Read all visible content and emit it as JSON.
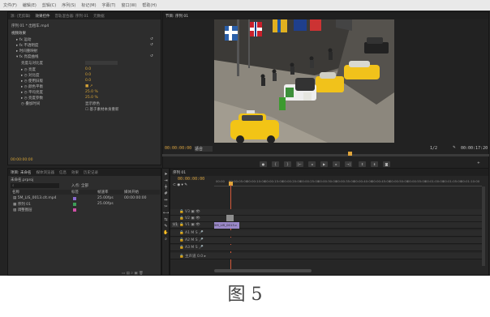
{
  "menu": [
    "文件(F)",
    "编辑(E)",
    "剪辑(C)",
    "序列(S)",
    "标记(M)",
    "字幕(T)",
    "窗口(W)",
    "帮助(H)"
  ],
  "top_left_panel": {
    "tabs": [
      "源: (无剪辑)",
      "效果控件",
      "音轨混合器: 序列 01",
      "元数据"
    ],
    "header": "序列 01 * 出租车.mp4",
    "section": "视频效果",
    "effects": [
      {
        "label": "运动",
        "value": ""
      },
      {
        "label": "不透明度",
        "value": ""
      },
      {
        "label": "时间重映射",
        "value": ""
      },
      {
        "label": "亮度曲线",
        "value": ""
      }
    ],
    "sub_label": "亮度与对比度",
    "params": [
      {
        "label": "亮度",
        "value": "0.0"
      },
      {
        "label": "对比度",
        "value": "0.0"
      },
      {
        "label": "使用旧版",
        "value": "0.0"
      },
      {
        "label": "颜色平衡",
        "value": "0.0"
      },
      {
        "label": "平均亮度",
        "value": "25.0 %"
      },
      {
        "label": "亮度参数",
        "value": "25.0 %"
      }
    ],
    "extra_label": "叠加时间",
    "extra_value": "显示原色",
    "extra_value2": "基于素材本身重新"
  },
  "program": {
    "title": "节目: 序列 01",
    "timecode_left": "00:00:00:00",
    "fit": "适合",
    "zoom": "1/2",
    "timecode_right": "00:00:17:20"
  },
  "project": {
    "tabs": [
      "项目: 未命名",
      "媒体浏览器",
      "信息",
      "效果",
      "历史记录"
    ],
    "name": "未命名.prproj",
    "search_hint": "入点: 全部",
    "columns": [
      "名称",
      "标签",
      "帧速率",
      "媒体开始"
    ],
    "items": [
      {
        "name": "5M_LIS_0013.clt.mp4",
        "rate": "25.00fps",
        "start": "00:00:00:00",
        "color": "#8a6ad0"
      },
      {
        "name": "序列 01",
        "rate": "25.00fps",
        "start": "",
        "color": "#3d9e57"
      },
      {
        "name": "调整图层",
        "rate": "",
        "start": "",
        "color": "#cf4fa6"
      }
    ]
  },
  "timeline": {
    "title": "序列 01",
    "timecode": "00:00:00:00",
    "ruler": [
      "00:00",
      "00:00:05:00",
      "00:00:10:00",
      "00:00:15:00",
      "00:00:20:00",
      "00:00:25:00",
      "00:00:30:00",
      "00:00:35:00",
      "00:00:40:00",
      "00:00:45:00",
      "00:00:50:00",
      "00:00:55:00",
      "00:01:00:00",
      "00:01:05:00",
      "00:01:10:00",
      "00:01:15:00"
    ],
    "video_tracks": [
      "V3",
      "V2",
      "V1"
    ],
    "audio_tracks": [
      "A1",
      "A2",
      "A3"
    ],
    "master": "主声道",
    "master_value": "0.0",
    "clip_label": "5M_LIS_0013.c"
  },
  "caption": "图 5"
}
